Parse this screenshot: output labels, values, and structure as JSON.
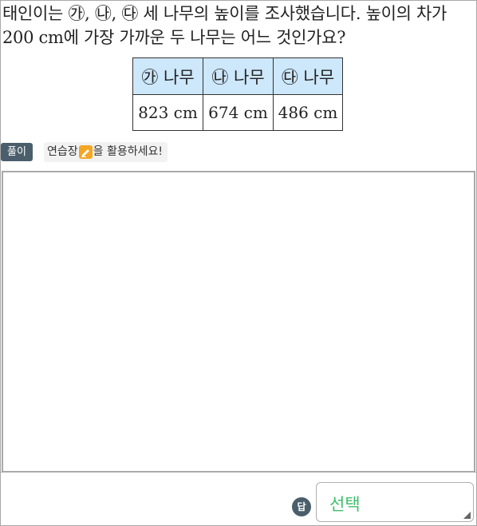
{
  "question": {
    "text": "태인이는 ㉮, ㉯, ㉰ 세 나무의 높이를 조사했습니다. 높이의 차가 200 cm에 가장 가까운 두 나무는 어느 것인가요?"
  },
  "table": {
    "headers": [
      "㉮ 나무",
      "㉯ 나무",
      "㉰ 나무"
    ],
    "values": [
      "823 cm",
      "674 cm",
      "486 cm"
    ]
  },
  "solution": {
    "badge": "풀이",
    "tip_before": "연습장",
    "tip_after": "을 활용하세요!"
  },
  "answer": {
    "badge": "답",
    "select_value": "선택"
  },
  "colors": {
    "header_bg": "#cde7fb",
    "badge_bg": "#4b5e6b",
    "select_text": "#3fbf6b",
    "pencil_icon": "#f5a623"
  },
  "icons": {
    "pencil": "pencil-icon",
    "resize": "resize-handle-icon"
  }
}
